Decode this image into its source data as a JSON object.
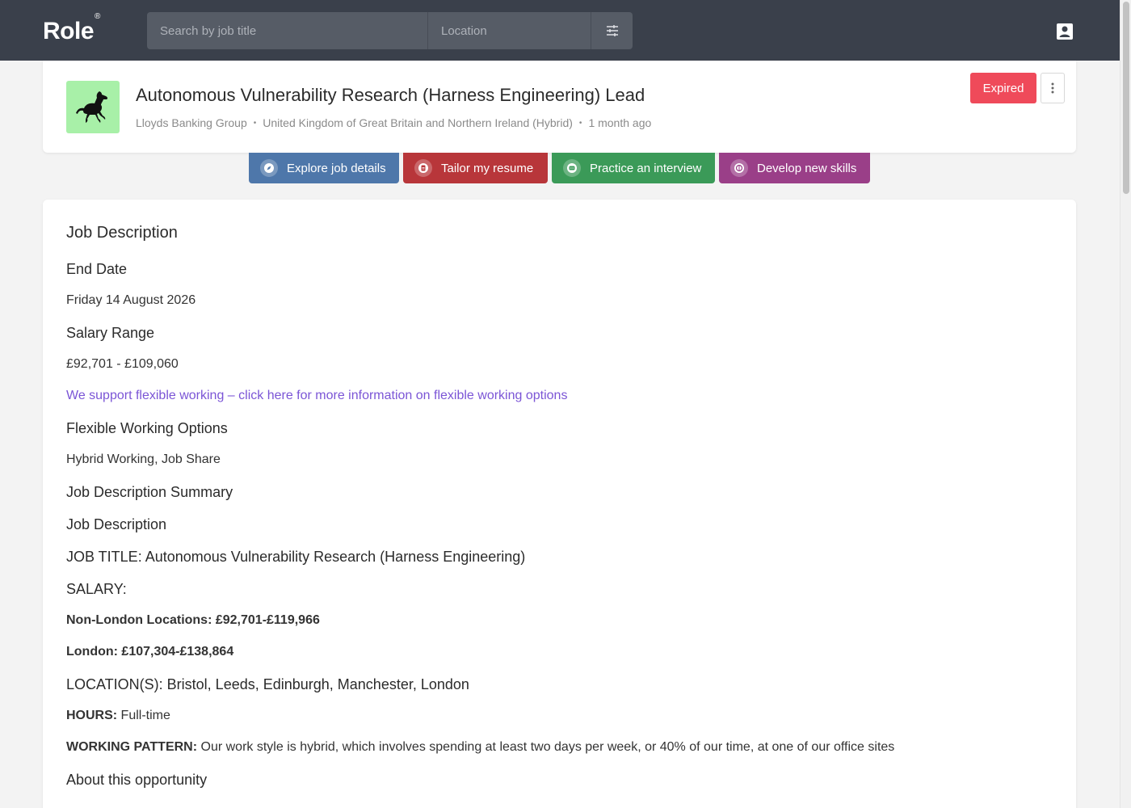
{
  "header": {
    "logo": "Role",
    "logo_mark": "®",
    "search_placeholder": "Search by job title",
    "location_placeholder": "Location"
  },
  "job": {
    "title": "Autonomous Vulnerability Research (Harness Engineering) Lead",
    "company": "Lloyds Banking Group",
    "location": "United Kingdom of Great Britain and Northern Ireland (Hybrid)",
    "posted": "1 month ago",
    "status": "Expired",
    "logo_color": "#a8f0a8"
  },
  "actions": {
    "explore": "Explore job details",
    "tailor": "Tailor my resume",
    "practice": "Practice an interview",
    "develop": "Develop new skills"
  },
  "description": {
    "heading": "Job Description",
    "end_date_label": "End Date",
    "end_date": "Friday 14 August 2026",
    "salary_label": "Salary Range",
    "salary": "£92,701 - £109,060",
    "flex_link": "We support flexible working – click here for more information on flexible working options",
    "flex_label": "Flexible Working Options",
    "flex_value": "Hybrid Working, Job Share",
    "summary_label": "Job Description Summary",
    "jd_label": "Job Description",
    "job_title_line": "JOB TITLE: Autonomous Vulnerability Research (Harness Engineering)",
    "salary_caps": "SALARY:",
    "non_london": "Non-London Locations: £92,701-£119,966",
    "london": "London: £107,304-£138,864",
    "locations": "LOCATION(S): Bristol, Leeds, Edinburgh, Manchester, London",
    "hours_label": "HOURS:",
    "hours_value": " Full-time",
    "pattern_label": "WORKING PATTERN:",
    "pattern_value": " Our work style is hybrid, which involves spending at least two days per week, or 40% of our time, at one of our office sites",
    "about_label": "About this opportunity"
  }
}
